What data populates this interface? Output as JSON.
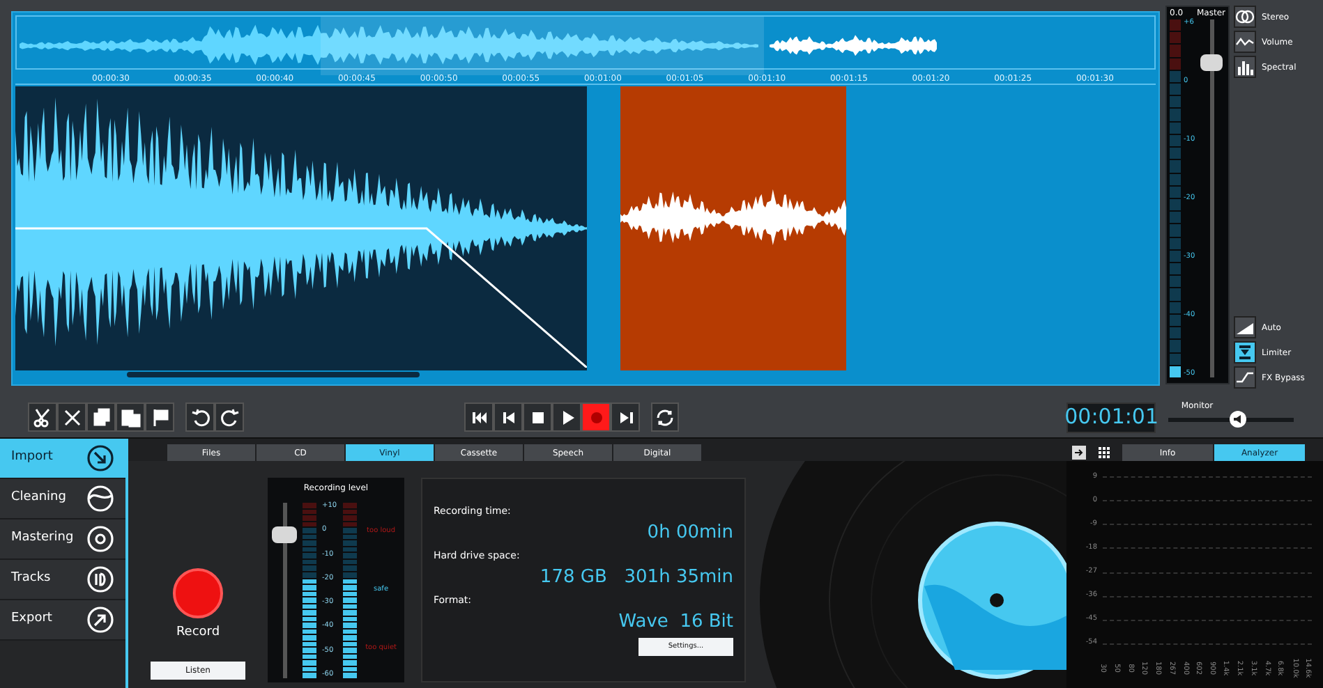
{
  "timeline": {
    "labels": [
      "00:00:30",
      "00:00:35",
      "00:00:40",
      "00:00:45",
      "00:00:50",
      "00:00:55",
      "00:01:00",
      "00:01:05",
      "00:01:10",
      "00:01:15",
      "00:01:20",
      "00:01:25",
      "00:01:30"
    ]
  },
  "mixer": {
    "peak": "0.0",
    "title": "Master",
    "scale": [
      "+6",
      "0",
      "-10",
      "-20",
      "-30",
      "-40",
      "-50"
    ],
    "fader": {
      "level": 0.88
    },
    "meter": {
      "level": 0.03
    },
    "views": [
      {
        "label": "Stereo",
        "kind": "stereo",
        "on": false
      },
      {
        "label": "Volume",
        "kind": "volume",
        "on": false
      },
      {
        "label": "Spectral",
        "kind": "spectral",
        "on": false
      }
    ],
    "effects": [
      {
        "label": "Auto",
        "kind": "auto",
        "on": false
      },
      {
        "label": "Limiter",
        "kind": "limiter",
        "on": true
      },
      {
        "label": "FX Bypass",
        "kind": "bypass",
        "on": false
      }
    ]
  },
  "monitor": {
    "label": "Monitor",
    "level": 0.55
  },
  "edit_tools": [
    {
      "kind": "scissors"
    },
    {
      "kind": "delete"
    },
    {
      "kind": "copy"
    },
    {
      "kind": "paste"
    },
    {
      "kind": "flag"
    },
    {
      "kind": "undo"
    },
    {
      "kind": "redo"
    }
  ],
  "transport": [
    {
      "kind": "start",
      "on": false
    },
    {
      "kind": "prev",
      "on": false
    },
    {
      "kind": "stop",
      "on": false
    },
    {
      "kind": "play",
      "on": false
    },
    {
      "kind": "record",
      "on": true
    },
    {
      "kind": "end",
      "on": false
    }
  ],
  "time": "00:01:01",
  "sidebar": [
    {
      "label": "Import",
      "kind": "import",
      "selected": true
    },
    {
      "label": "Cleaning",
      "kind": "cleaning",
      "selected": false
    },
    {
      "label": "Mastering",
      "kind": "mastering",
      "selected": false
    },
    {
      "label": "Tracks",
      "kind": "tracks",
      "selected": false
    },
    {
      "label": "Export",
      "kind": "export",
      "selected": false
    }
  ],
  "source_tabs": [
    {
      "label": "Files",
      "selected": false
    },
    {
      "label": "CD",
      "selected": false
    },
    {
      "label": "Vinyl",
      "selected": true
    },
    {
      "label": "Cassette",
      "selected": false
    },
    {
      "label": "Speech",
      "selected": false
    },
    {
      "label": "Digital",
      "selected": false
    }
  ],
  "record": {
    "label": "Record",
    "listen": "Listen"
  },
  "recording_level": {
    "title": "Recording level",
    "scale": [
      "+10",
      "0",
      "-10",
      "-20",
      "-30",
      "-40",
      "-50",
      "-60"
    ],
    "zones": [
      "too loud",
      "safe",
      "too quiet"
    ],
    "slider": {
      "level": 0.82
    },
    "meters": [
      {
        "level": 0.57
      },
      {
        "level": 0.57
      }
    ]
  },
  "info": {
    "rows": [
      {
        "label": "Recording time:",
        "value": "0h 00min"
      },
      {
        "label": "Hard drive space:",
        "value": "178 GB   301h 35min"
      },
      {
        "label": "Format:",
        "value": "Wave  16 Bit"
      }
    ],
    "settings": "Settings..."
  },
  "panel_tabs": [
    {
      "label": "Info",
      "selected": false
    },
    {
      "label": "Analyzer",
      "selected": true
    }
  ],
  "analyzer": {
    "y_labels": [
      "9",
      "0",
      "-9",
      "-18",
      "-27",
      "-36",
      "-45",
      "-54"
    ],
    "x_labels": [
      "30",
      "50",
      "80",
      "120",
      "180",
      "267",
      "400",
      "602",
      "900",
      "1.4k",
      "2.1k",
      "3.1k",
      "4.7k",
      "6.8k",
      "10.0k",
      "14.6k"
    ]
  }
}
